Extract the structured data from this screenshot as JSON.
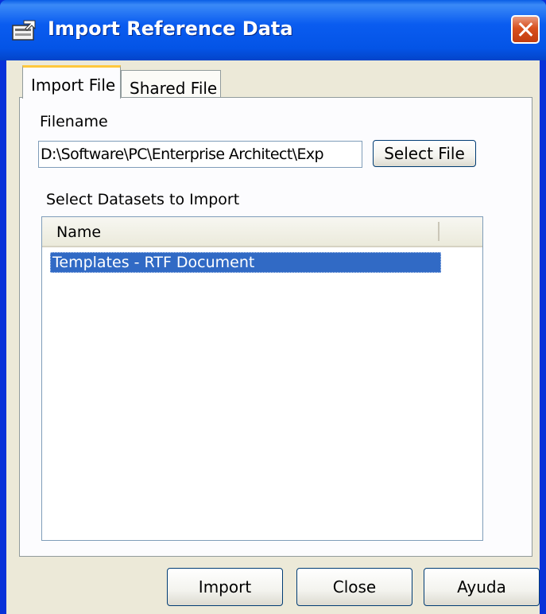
{
  "window": {
    "title": "Import Reference Data",
    "icon": "import-data-icon",
    "close_icon": "close-icon"
  },
  "tabs": [
    {
      "label": "Import File",
      "active": true
    },
    {
      "label": "Shared File",
      "active": false
    }
  ],
  "form": {
    "filename_label": "Filename",
    "filename_value": "D:\\Software\\PC\\Enterprise Architect\\Exp",
    "select_file_button": "Select File",
    "datasets_label": "Select Datasets to Import",
    "list_header": "Name",
    "list_items": [
      "Templates - RTF Document"
    ]
  },
  "buttons": {
    "import": "Import",
    "close": "Close",
    "help": "Ayuda"
  },
  "colors": {
    "titlebar": "#0454e6",
    "selection": "#316ac5",
    "dialog_bg": "#ece9d8",
    "active_tab_accent": "#ffc83c"
  }
}
